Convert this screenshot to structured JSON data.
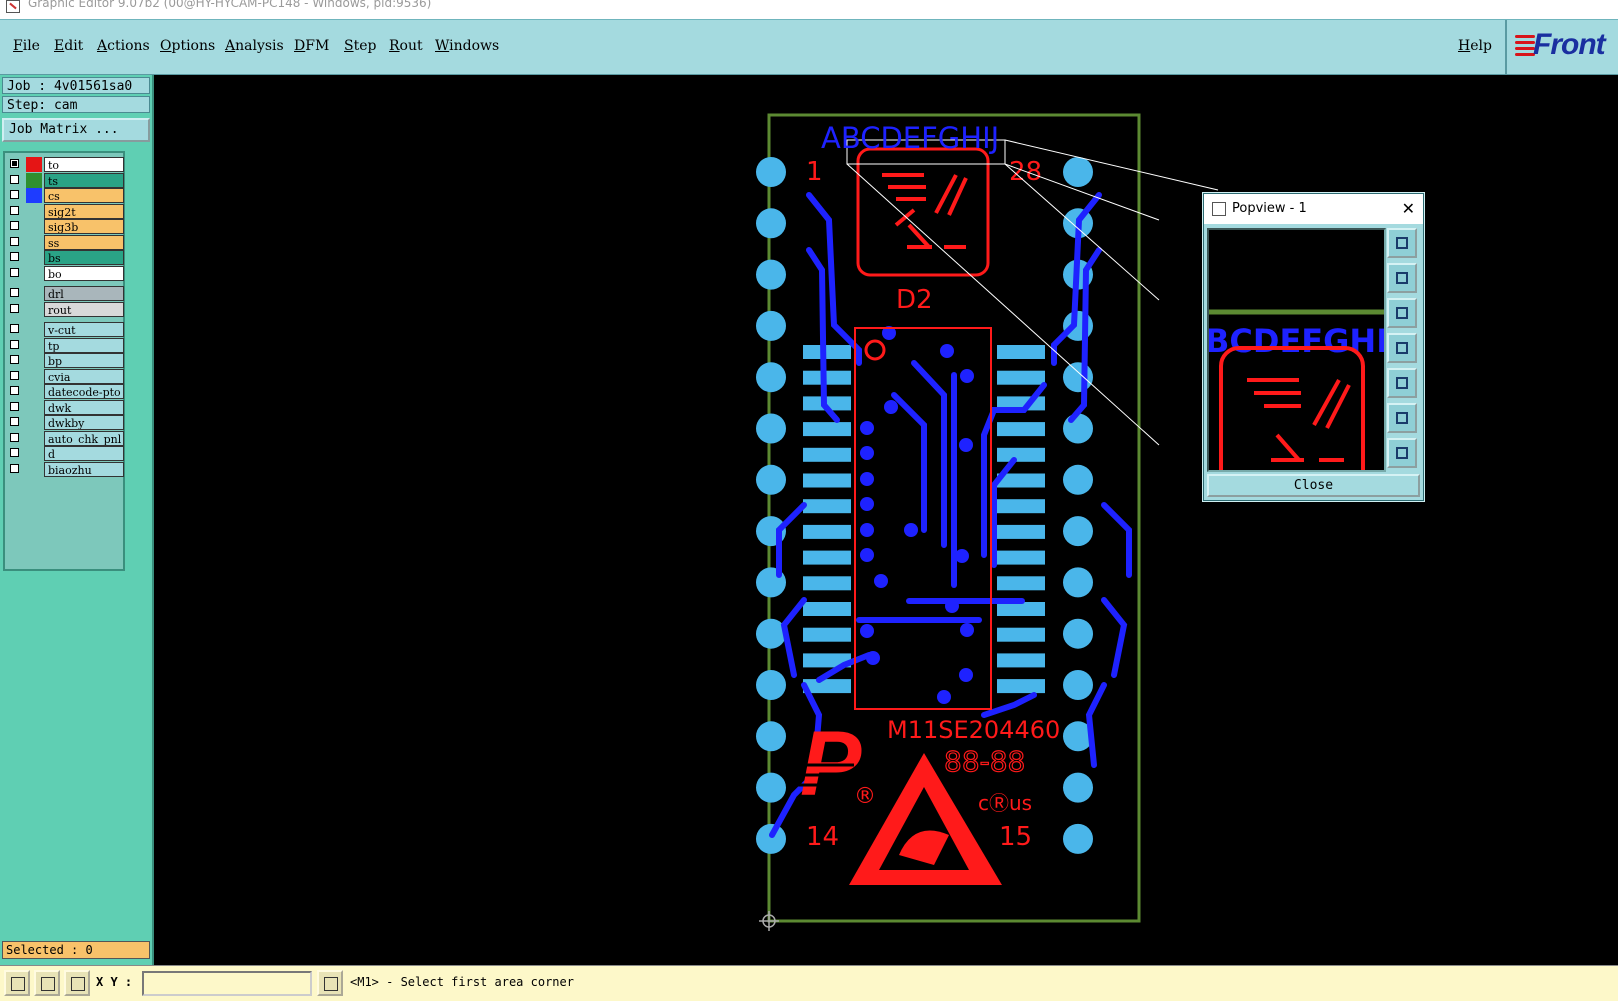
{
  "window": {
    "title": "Graphic Editor 9.07b2 (00@HY-HYCAM-PC148 - Windows, pid:9536)"
  },
  "menubar": {
    "items": [
      "File",
      "Edit",
      "Actions",
      "Options",
      "Analysis",
      "DFM",
      "Step",
      "Rout",
      "Windows"
    ],
    "help": "Help",
    "brand": "Front"
  },
  "left_panel": {
    "job": "Job : 4v01561sa0",
    "step": "Step: cam",
    "job_matrix_button": "Job Matrix ...",
    "selected": "Selected : 0",
    "layers": [
      {
        "name": "to",
        "checked": true,
        "swatch": "#e51515",
        "bg": "#ffffff"
      },
      {
        "name": "ts",
        "checked": false,
        "swatch": "#2f8f2f",
        "bg": "#2aa386"
      },
      {
        "name": "cs",
        "checked": false,
        "swatch": "#1e3cff",
        "bg": "#f8c26a"
      },
      {
        "name": "sig2t",
        "checked": false,
        "swatch": "",
        "bg": "#f8c26a"
      },
      {
        "name": "sig3b",
        "checked": false,
        "swatch": "",
        "bg": "#f8c26a"
      },
      {
        "name": "ss",
        "checked": false,
        "swatch": "",
        "bg": "#f8c26a"
      },
      {
        "name": "bs",
        "checked": false,
        "swatch": "",
        "bg": "#2aa386"
      },
      {
        "name": "bo",
        "checked": false,
        "swatch": "",
        "bg": "#ffffff"
      },
      {
        "name": "drl",
        "checked": false,
        "swatch": "",
        "bg": "#a9b6bb"
      },
      {
        "name": "rout",
        "checked": false,
        "swatch": "",
        "bg": "#d9d9d9"
      },
      {
        "name": "v-cut",
        "checked": false,
        "swatch": "",
        "bg": "#a4dadf"
      },
      {
        "name": "tp",
        "checked": false,
        "swatch": "",
        "bg": "#a4dadf"
      },
      {
        "name": "bp",
        "checked": false,
        "swatch": "",
        "bg": "#a4dadf"
      },
      {
        "name": "cvia",
        "checked": false,
        "swatch": "",
        "bg": "#a4dadf"
      },
      {
        "name": "datecode-pto",
        "checked": false,
        "swatch": "",
        "bg": "#a4dadf"
      },
      {
        "name": "dwk",
        "checked": false,
        "swatch": "",
        "bg": "#a4dadf"
      },
      {
        "name": "dwkby",
        "checked": false,
        "swatch": "",
        "bg": "#a4dadf"
      },
      {
        "name": "auto_chk_pnl",
        "checked": false,
        "swatch": "",
        "bg": "#a4dadf"
      },
      {
        "name": "d",
        "checked": false,
        "swatch": "",
        "bg": "#a4dadf"
      },
      {
        "name": "biaozhu",
        "checked": false,
        "swatch": "",
        "bg": "#a4dadf"
      }
    ]
  },
  "board": {
    "top_letters": "ABCDEFGHIJ",
    "pin_first": "1",
    "pin_28": "28",
    "pin_14": "14",
    "pin_15": "15",
    "ref_d2": "D2",
    "part_number": "M11SE204460",
    "date_code": "88-88",
    "cert_mark": "cⓇus",
    "registered_mark": "®",
    "logo_letter": "P"
  },
  "popview": {
    "title": "Popview - 1",
    "preview_text": "BCDEFGHI",
    "close_button": "Close",
    "tools": [
      "zoom-window-icon",
      "pan-up-icon",
      "pan-down-icon",
      "pan-left-icon",
      "pan-right-icon",
      "fit-icon",
      "center-icon"
    ]
  },
  "status": {
    "xy_label": "X Y :",
    "xy_value": "",
    "message": "<M1> - Select first area corner"
  },
  "colors": {
    "menu_bg": "#a4dadf",
    "panel_bg": "#5fcfb3",
    "trace_blue": "#1e22ff",
    "pad_cyan": "#4ab6ea",
    "silkscreen_red": "#ff1a1a",
    "outline_green": "#5c8a32"
  }
}
